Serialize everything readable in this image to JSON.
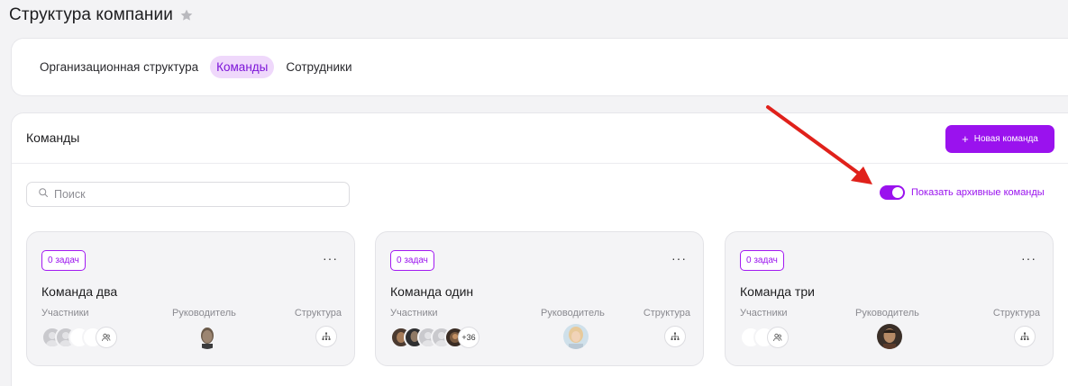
{
  "page": {
    "title": "Структура компании"
  },
  "tabs": [
    {
      "label": "Организационная структура",
      "active": false
    },
    {
      "label": "Команды",
      "active": true
    },
    {
      "label": "Сотрудники",
      "active": false
    }
  ],
  "section": {
    "title": "Команды",
    "new_button_label": "Новая команда",
    "search_placeholder": "Поиск",
    "archive_toggle_label": "Показать архивные команды",
    "archive_toggle_on": true
  },
  "labels": {
    "members": "Участники",
    "leader": "Руководитель",
    "structure": "Структура"
  },
  "teams": [
    {
      "badge": "0 задач",
      "name": "Команда два",
      "extra_members": ""
    },
    {
      "badge": "0 задач",
      "name": "Команда один",
      "extra_members": "+36"
    },
    {
      "badge": "0 задач",
      "name": "Команда три",
      "extra_members": ""
    }
  ],
  "colors": {
    "accent": "#9a12ee",
    "accent_soft": "#efd8fb",
    "annotation_arrow": "#e0211b"
  }
}
